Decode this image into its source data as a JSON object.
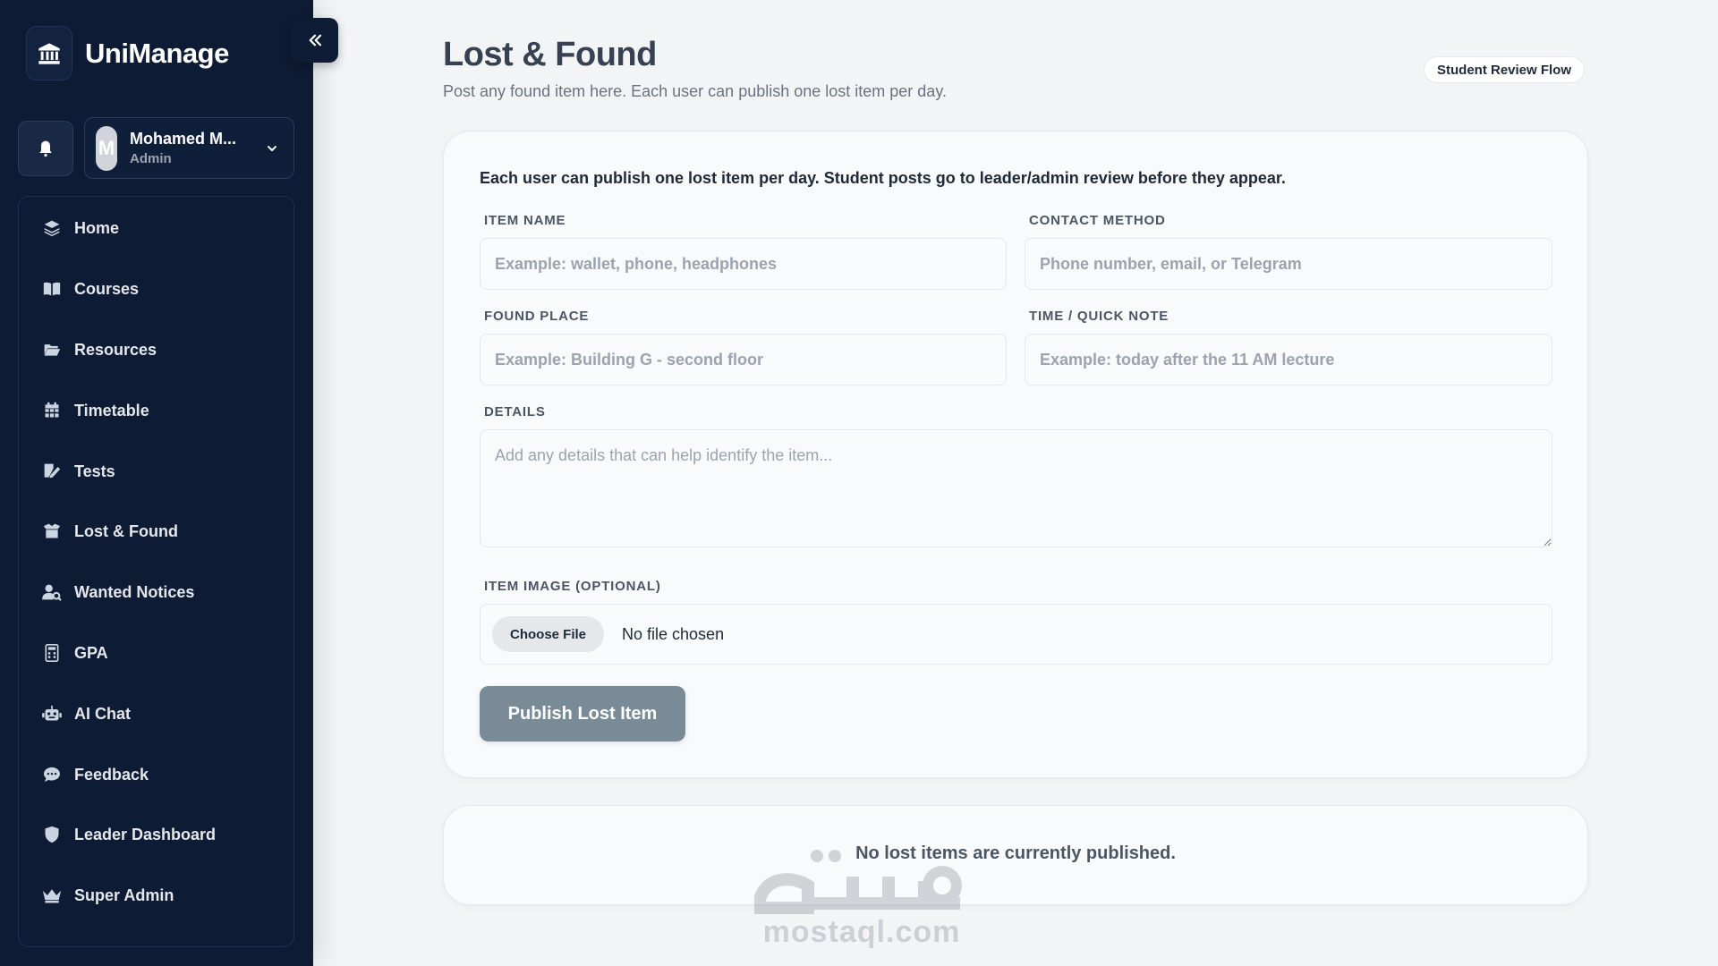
{
  "brand": {
    "name": "UniManage"
  },
  "user": {
    "initial": "M",
    "name": "Mohamed M...",
    "role": "Admin"
  },
  "sidebar": {
    "items": [
      {
        "label": "Home",
        "icon": "layers-icon"
      },
      {
        "label": "Courses",
        "icon": "book-icon"
      },
      {
        "label": "Resources",
        "icon": "folder-icon"
      },
      {
        "label": "Timetable",
        "icon": "calendar-icon"
      },
      {
        "label": "Tests",
        "icon": "edit-icon"
      },
      {
        "label": "Lost & Found",
        "icon": "box-icon"
      },
      {
        "label": "Wanted Notices",
        "icon": "user-search-icon"
      },
      {
        "label": "GPA",
        "icon": "calculator-icon"
      },
      {
        "label": "AI Chat",
        "icon": "robot-icon"
      },
      {
        "label": "Feedback",
        "icon": "comment-icon"
      },
      {
        "label": "Leader Dashboard",
        "icon": "shield-icon"
      },
      {
        "label": "Super Admin",
        "icon": "crown-icon"
      }
    ]
  },
  "page": {
    "title": "Lost & Found",
    "subtitle": "Post any found item here. Each user can publish one lost item per day.",
    "badge": "Student Review Flow"
  },
  "form": {
    "note": "Each user can publish one lost item per day. Student posts go to leader/admin review before they appear.",
    "item_name": {
      "label": "ITEM NAME",
      "placeholder": "Example: wallet, phone, headphones",
      "value": ""
    },
    "contact_method": {
      "label": "CONTACT METHOD",
      "placeholder": "Phone number, email, or Telegram",
      "value": ""
    },
    "found_place": {
      "label": "FOUND PLACE",
      "placeholder": "Example: Building G - second floor",
      "value": ""
    },
    "time_note": {
      "label": "TIME / QUICK NOTE",
      "placeholder": "Example: today after the 11 AM lecture",
      "value": ""
    },
    "details": {
      "label": "DETAILS",
      "placeholder": "Add any details that can help identify the item...",
      "value": ""
    },
    "image": {
      "label": "ITEM IMAGE (OPTIONAL)",
      "button": "Choose File",
      "status": "No file chosen"
    },
    "submit_label": "Publish Lost Item"
  },
  "list": {
    "empty_text": "No lost items are currently published."
  },
  "watermark": {
    "arabic": "مستقل",
    "latin": "mostaql.com"
  },
  "colors": {
    "sidebar_bg": "#0d1b34",
    "page_bg": "#f3f4f6",
    "publish_button": "#7a8b98"
  }
}
